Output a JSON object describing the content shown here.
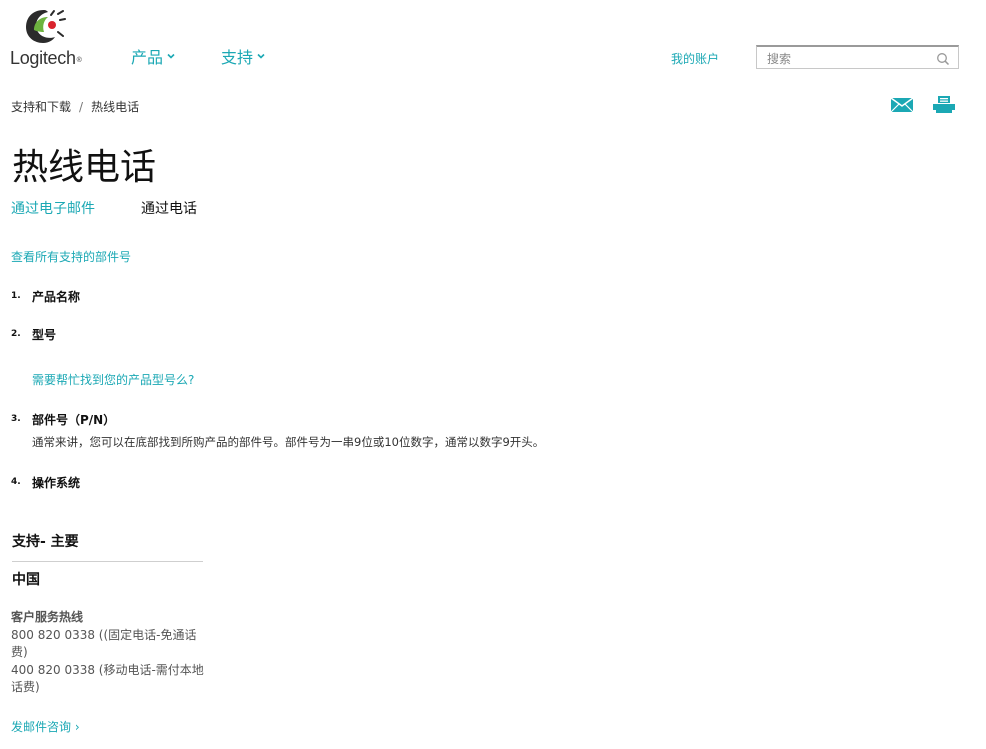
{
  "brand": {
    "name": "Logitech"
  },
  "nav": {
    "products": "产品",
    "support": "支持"
  },
  "header": {
    "account": "我的账户",
    "search_placeholder": "搜索"
  },
  "breadcrumb": {
    "home": "支持和下载",
    "sep": "/",
    "current": "热线电话"
  },
  "page": {
    "title": "热线电话",
    "tab_email": "通过电子邮件",
    "tab_phone": "通过电话",
    "all_parts_link": "查看所有支持的部件号"
  },
  "steps": [
    {
      "num": "1.",
      "label": "产品名称"
    },
    {
      "num": "2.",
      "label": "型号",
      "help": "需要帮忙找到您的产品型号么?"
    },
    {
      "num": "3.",
      "label": "部件号（P/N）",
      "desc": "通常来讲，您可以在底部找到所购产品的部件号。部件号为一串9位或10位数字，通常以数字9开头。"
    },
    {
      "num": "4.",
      "label": "操作系统"
    }
  ],
  "support": {
    "heading": "支持- 主要",
    "country": "中国",
    "hotline_title": "客户服务热线",
    "phone_1": "800 820 0338 ((固定电话-免通话费)",
    "phone_2": "400 820 0338 (移动电话-需付本地话费)",
    "mail_link": "发邮件咨询 ›"
  }
}
